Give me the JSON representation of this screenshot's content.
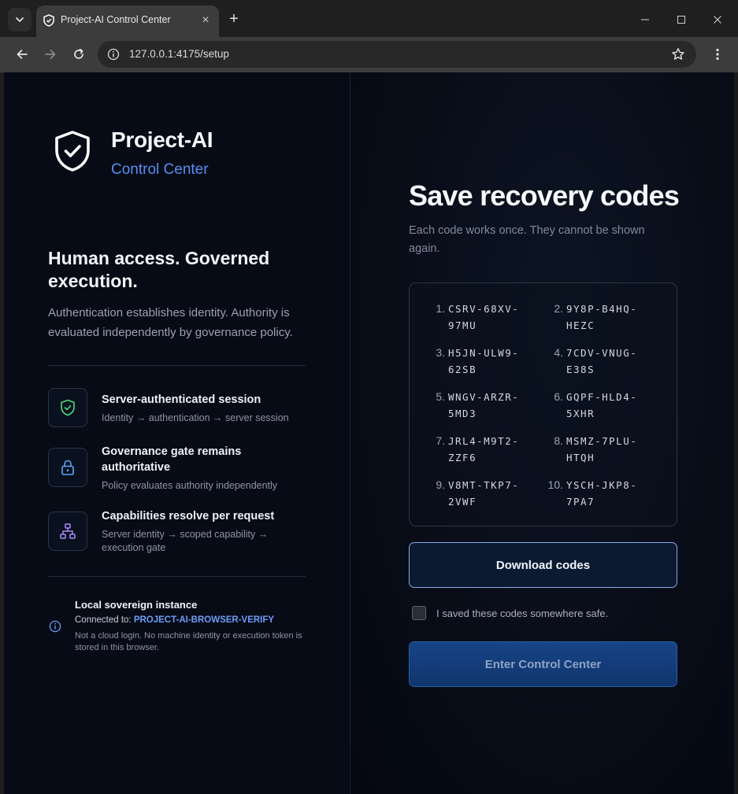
{
  "browser": {
    "tab_title": "Project-AI Control Center",
    "tab_close": "×",
    "new_tab": "+",
    "url": "127.0.0.1:4175/setup"
  },
  "brand": {
    "name": "Project-AI",
    "subtitle": "Control Center"
  },
  "intro": {
    "headline": "Human access. Governed execution.",
    "description": "Authentication establishes identity. Authority is evaluated independently by governance policy."
  },
  "features": [
    {
      "title": "Server-authenticated session",
      "subtitle": "Identity → authentication → server session",
      "icon": "shield-check-icon"
    },
    {
      "title": "Governance gate remains authoritative",
      "subtitle": "Policy evaluates authority independently",
      "icon": "lock-icon"
    },
    {
      "title": "Capabilities resolve per request",
      "subtitle": "Server identity → scoped capability → execution gate",
      "icon": "network-icon"
    }
  ],
  "instance": {
    "title": "Local sovereign instance",
    "connected_label": "Connected to:",
    "connected_value": "PROJECT-AI-BROWSER-VERIFY",
    "note": "Not a cloud login. No machine identity or execution token is stored in this browser."
  },
  "recovery": {
    "title": "Save recovery codes",
    "subtitle": "Each code works once. They cannot be shown again.",
    "codes": [
      {
        "num": "1.",
        "code": "CSRV-68XV-97MU"
      },
      {
        "num": "2.",
        "code": "9Y8P-B4HQ-HEZC"
      },
      {
        "num": "3.",
        "code": "H5JN-ULW9-62SB"
      },
      {
        "num": "4.",
        "code": "7CDV-VNUG-E38S"
      },
      {
        "num": "5.",
        "code": "WNGV-ARZR-5MD3"
      },
      {
        "num": "6.",
        "code": "GQPF-HLD4-5XHR"
      },
      {
        "num": "7.",
        "code": "JRL4-M9T2-ZZF6"
      },
      {
        "num": "8.",
        "code": "MSMZ-7PLU-HTQH"
      },
      {
        "num": "9.",
        "code": "V8MT-TKP7-2VWF"
      },
      {
        "num": "10.",
        "code": "YSCH-JKP8-7PA7"
      }
    ],
    "download_label": "Download codes",
    "checkbox_label": "I saved these codes somewhere safe.",
    "checkbox_checked": false,
    "enter_label": "Enter Control Center"
  },
  "colors": {
    "accent": "#5b8def",
    "background": "#060b16",
    "feature_green": "#4ade80",
    "feature_blue": "#60a5fa",
    "feature_purple": "#a78bfa"
  }
}
